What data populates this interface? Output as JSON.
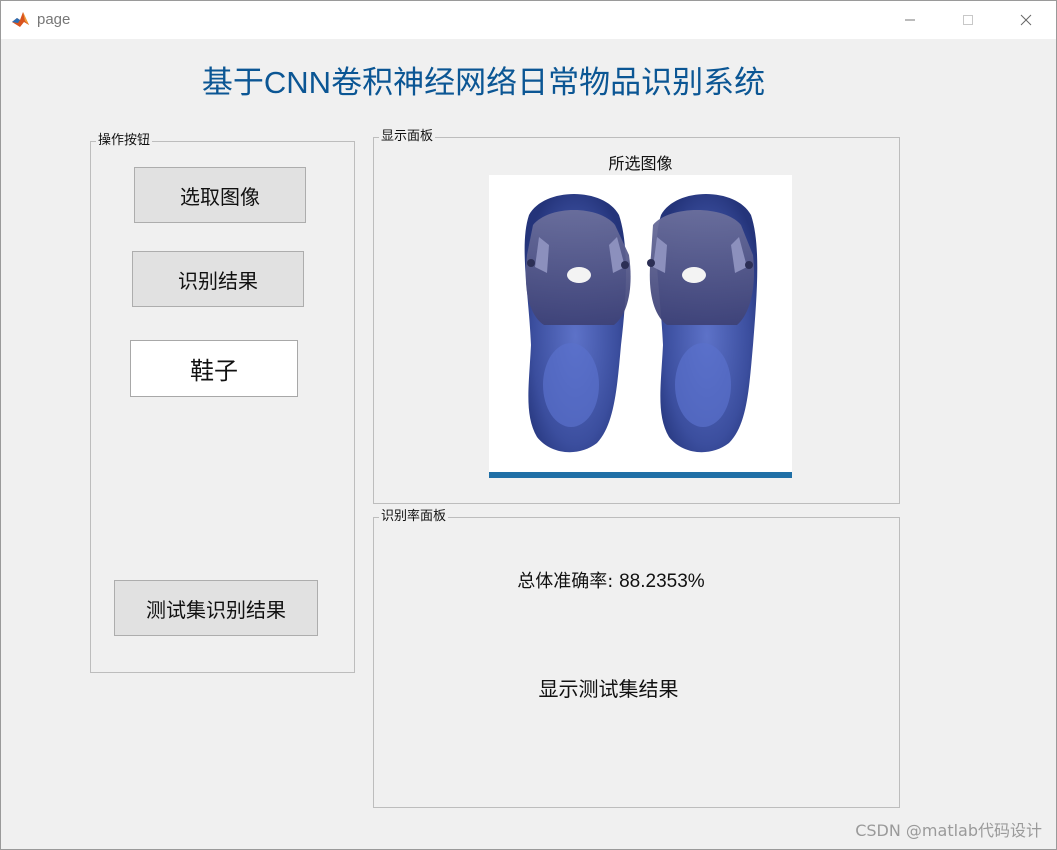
{
  "window": {
    "title": "page"
  },
  "app": {
    "title": "基于CNN卷积神经网络日常物品识别系统"
  },
  "ops_panel": {
    "title": "操作按钮",
    "select_image_label": "选取图像",
    "recognize_label": "识别结果",
    "result_value": "鞋子",
    "test_set_label": "测试集识别结果"
  },
  "display_panel": {
    "title": "显示面板",
    "image_caption": "所选图像"
  },
  "rate_panel": {
    "title": "识别率面板",
    "accuracy_label": "总体准确率:",
    "accuracy_value": "88.2353%",
    "test_result_text": "显示测试集结果"
  },
  "watermark": "CSDN @matlab代码设计",
  "colors": {
    "title_blue": "#0b5694",
    "background": "#f0f0f0",
    "button_face": "#e1e1e1"
  },
  "icons": {
    "app": "matlab-logo-icon",
    "minimize": "minimize-icon",
    "maximize": "maximize-icon",
    "close": "close-icon"
  }
}
